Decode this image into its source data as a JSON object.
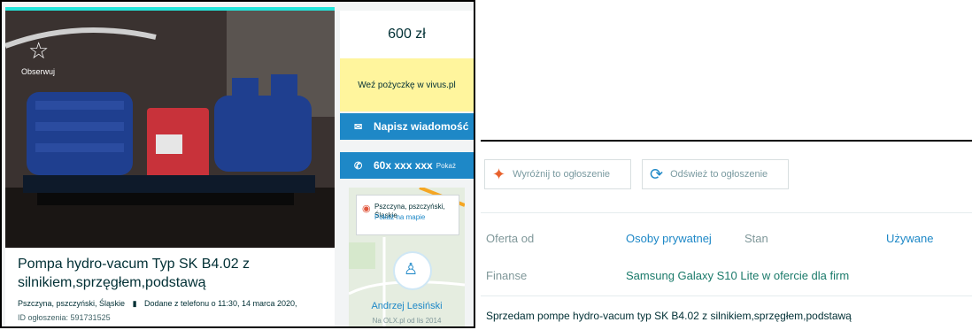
{
  "listing": {
    "observe_label": "Obserwuj",
    "title": "Pompa hydro-vacum Typ SK B4.02 z silnikiem,sprzęgłem,podstawą",
    "location": "Pszczyna, pszczyński, Śląskie",
    "added": "Dodane z telefonu  o 11:30, 14 marca 2020,",
    "ad_id": "ID ogłoszenia: 591731525"
  },
  "sidebar": {
    "price": "600 zł",
    "loan_text": "Weź pożyczkę w vivus.pl",
    "message_button": "Napisz wiadomość",
    "phone_number": "60x xxx xxx",
    "phone_show": "Pokaż",
    "map_location": "Pszczyna, pszczyński, Śląskie",
    "map_link": "Pokaż na mapie",
    "user_name": "Andrzej Lesiński",
    "user_since": "Na OLX.pl od lis 2014"
  },
  "actions": {
    "promote": "Wyróżnij to ogłoszenie",
    "refresh": "Odśwież to ogłoszenie"
  },
  "params": {
    "offer_from_label": "Oferta od",
    "offer_from_value": "Osoby prywatnej",
    "condition_label": "Stan",
    "condition_value": "Używane",
    "finance_label": "Finanse",
    "finance_value": "Samsung Galaxy S10 Lite w ofercie dla firm"
  },
  "description": "Sprzedam pompe hydro-vacum typ SK B4.02 z silnikiem,sprzęgłem,podstawą",
  "icons": [
    "star-icon",
    "mail-icon",
    "phone-icon",
    "pin-icon",
    "user-icon",
    "kite-icon",
    "refresh-icon"
  ],
  "colors": {
    "accent": "#1e88c7",
    "top_bar": "#23e5db",
    "loan_bg": "#fff59d"
  }
}
